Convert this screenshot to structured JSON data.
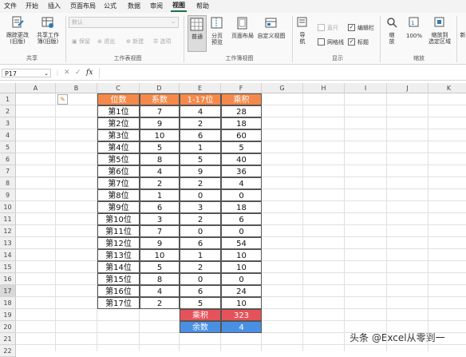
{
  "menu": [
    "文件",
    "开始",
    "插入",
    "页面布局",
    "公式",
    "数据",
    "审阅",
    "视图",
    "帮助"
  ],
  "menu_active": "视图",
  "ribbon": {
    "track_changes": "跟踪更改\n(旧版)",
    "share_workbook": "共享工作\n簿(旧版)",
    "group_share": "共享",
    "sheet_view_select": "默认",
    "keep": "保留",
    "exit": "退出",
    "new": "新建",
    "options": "选项",
    "group_sheet_view": "工作表视图",
    "normal": "普通",
    "page_break": "分页\n预览",
    "page_layout": "页面布局",
    "custom_views": "自定义视图",
    "group_workbook_views": "工作簿视图",
    "navigation": "导\n航",
    "ruler": "直尺",
    "gridlines": "网格线",
    "formula_bar": "编辑栏",
    "headings": "标题",
    "group_show": "显示",
    "zoom": "缩\n放",
    "zoom100": "100%",
    "zoom_selection": "缩放到\n选定区域",
    "group_zoom": "缩放",
    "new_window": "新"
  },
  "name_box": "P17",
  "fx": "fx",
  "columns": [
    "A",
    "B",
    "C",
    "D",
    "E",
    "F",
    "G",
    "H",
    "I",
    "J",
    "K"
  ],
  "rows": [
    "1",
    "2",
    "3",
    "4",
    "5",
    "6",
    "7",
    "8",
    "9",
    "10",
    "11",
    "12",
    "13",
    "14",
    "15",
    "16",
    "17",
    "18",
    "19",
    "20",
    "21",
    "22"
  ],
  "table": {
    "headers": [
      "位数",
      "系数",
      "1-17位",
      "乘积"
    ],
    "rows": [
      [
        "第1位",
        "7",
        "4",
        "28"
      ],
      [
        "第2位",
        "9",
        "2",
        "18"
      ],
      [
        "第3位",
        "10",
        "6",
        "60"
      ],
      [
        "第4位",
        "5",
        "1",
        "5"
      ],
      [
        "第5位",
        "8",
        "5",
        "40"
      ],
      [
        "第6位",
        "4",
        "9",
        "36"
      ],
      [
        "第7位",
        "2",
        "2",
        "4"
      ],
      [
        "第8位",
        "1",
        "0",
        "0"
      ],
      [
        "第9位",
        "6",
        "3",
        "18"
      ],
      [
        "第10位",
        "3",
        "2",
        "6"
      ],
      [
        "第11位",
        "7",
        "0",
        "0"
      ],
      [
        "第12位",
        "9",
        "6",
        "54"
      ],
      [
        "第13位",
        "10",
        "1",
        "10"
      ],
      [
        "第14位",
        "5",
        "2",
        "10"
      ],
      [
        "第15位",
        "8",
        "0",
        "0"
      ],
      [
        "第16位",
        "4",
        "6",
        "24"
      ],
      [
        "第17位",
        "2",
        "5",
        "10"
      ]
    ],
    "sum_label": "乘积",
    "sum_value": "323",
    "mod_label": "余数",
    "mod_value": "4"
  },
  "colors": {
    "header_orange": "#f4894b",
    "sum_red": "#e5525a",
    "mod_blue": "#4a90e2",
    "excel_green": "#1e7145"
  },
  "watermark": "头条 @Excel从零到一"
}
